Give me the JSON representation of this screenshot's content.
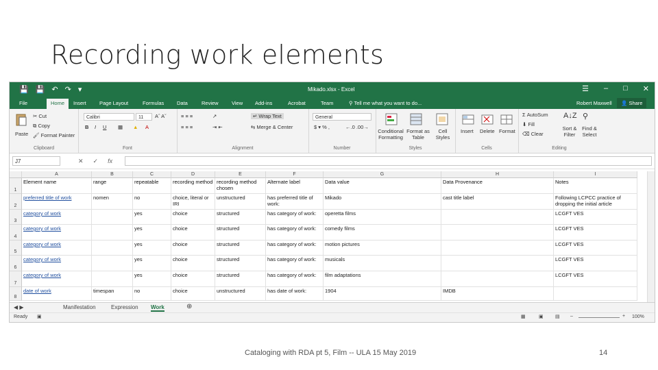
{
  "slide": {
    "title": "Recording work elements",
    "footer": "Cataloging with RDA pt 5, Film -- ULA 15 May 2019",
    "page_number": "14"
  },
  "excel": {
    "window_title": "Mikado.xlsx - Excel",
    "accent_color": "#217346",
    "tabs": [
      "File",
      "Home",
      "Insert",
      "Page Layout",
      "Formulas",
      "Data",
      "Review",
      "View",
      "Add-ins",
      "Acrobat",
      "Team"
    ],
    "active_tab": "Home",
    "tell_me": "Tell me what you want to do...",
    "user": "Robert Maxwell",
    "share": "Share",
    "ribbon": {
      "clipboard": {
        "paste": "Paste",
        "cut": "Cut",
        "copy": "Copy",
        "format_painter": "Format Painter",
        "label": "Clipboard"
      },
      "font": {
        "name": "Calibri",
        "size": "11",
        "label": "Font"
      },
      "alignment": {
        "wrap_text": "Wrap Text",
        "merge_center": "Merge & Center",
        "label": "Alignment"
      },
      "number": {
        "format": "General",
        "label": "Number"
      },
      "styles": {
        "conditional": "Conditional Formatting",
        "format_as_table": "Format as Table",
        "cell_styles": "Cell Styles",
        "label": "Styles"
      },
      "cells": {
        "insert": "Insert",
        "delete": "Delete",
        "format": "Format",
        "label": "Cells"
      },
      "editing": {
        "autosum": "AutoSum",
        "fill": "Fill",
        "clear": "Clear",
        "sort_filter": "Sort & Filter",
        "find_select": "Find & Select",
        "label": "Editing"
      }
    },
    "name_box": "J7",
    "columns": [
      "A",
      "B",
      "C",
      "D",
      "E",
      "F",
      "G",
      "H",
      "I"
    ],
    "header_row": [
      "Element name",
      "range",
      "repeatable",
      "recording method",
      "recording method chosen",
      "Alternate label",
      "Data value",
      "Data Provenance",
      "Notes"
    ],
    "rows": [
      {
        "num": "2",
        "cells": [
          "preferred title of work",
          "nomen",
          "no",
          "choice, literal or IRI",
          "unstructured",
          "has preferred title of work:",
          "Mikado",
          "cast title label",
          "Following LCPCC practice of dropping the initial article"
        ]
      },
      {
        "num": "3",
        "cells": [
          "category of work",
          "",
          "yes",
          "choice",
          "structured",
          "has category of work:",
          "operetta films",
          "",
          "LCGFT VES"
        ]
      },
      {
        "num": "4",
        "cells": [
          "category of work",
          "",
          "yes",
          "choice",
          "structured",
          "has category of work:",
          "comedy films",
          "",
          "LCGFT VES"
        ]
      },
      {
        "num": "5",
        "cells": [
          "category of work",
          "",
          "yes",
          "choice",
          "structured",
          "has category of work:",
          "motion pictures",
          "",
          "LCGFT VES"
        ]
      },
      {
        "num": "6",
        "cells": [
          "category of work",
          "",
          "yes",
          "choice",
          "structured",
          "has category of work:",
          "musicals",
          "",
          "LCGFT VES"
        ]
      },
      {
        "num": "7",
        "cells": [
          "category of work",
          "",
          "yes",
          "choice",
          "structured",
          "has category of work:",
          "film adaptations",
          "",
          "LCGFT VES"
        ]
      },
      {
        "num": "8",
        "cells": [
          "date of work",
          "timespan",
          "no",
          "choice",
          "unstructured",
          "has date of work:",
          "1904",
          "IMDB",
          ""
        ]
      }
    ],
    "sheets": [
      "Manifestation",
      "Expression",
      "Work"
    ],
    "active_sheet": "Work",
    "status": "Ready",
    "zoom": "100%"
  }
}
